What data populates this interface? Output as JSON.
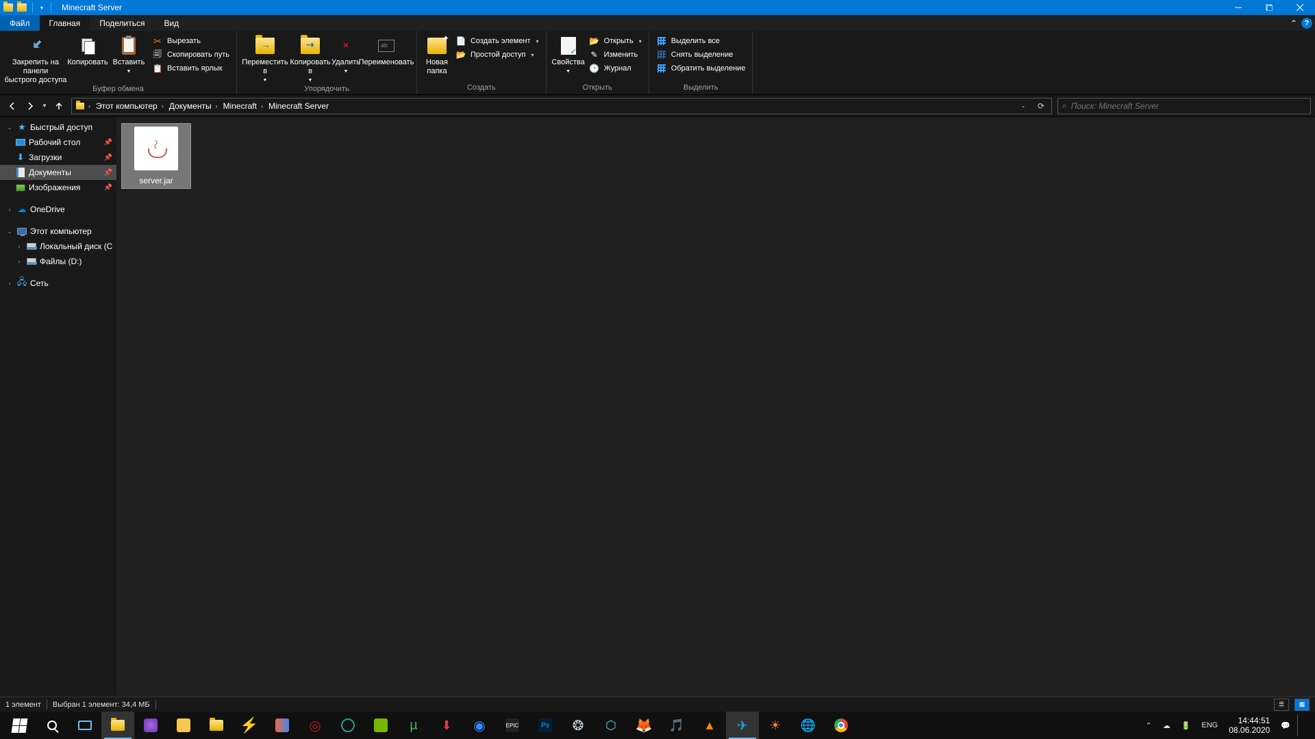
{
  "window": {
    "title": "Minecraft Server"
  },
  "tabs": {
    "file": "Файл",
    "home": "Главная",
    "share": "Поделиться",
    "view": "Вид"
  },
  "ribbon": {
    "pin": "Закрепить на панели\nбыстрого доступа",
    "copy": "Копировать",
    "paste": "Вставить",
    "cut": "Вырезать",
    "copy_path": "Скопировать путь",
    "paste_shortcut": "Вставить ярлык",
    "clipboard_group": "Буфер обмена",
    "move_to": "Переместить в",
    "copy_to": "Копировать в",
    "delete": "Удалить",
    "rename": "Переименовать",
    "organize_group": "Упорядочить",
    "new_folder": "Новая папка",
    "new_item": "Создать элемент",
    "easy_access": "Простой доступ",
    "create_group": "Создать",
    "properties": "Свойства",
    "open": "Открыть",
    "edit": "Изменить",
    "history": "Журнал",
    "open_group": "Открыть",
    "select_all": "Выделить все",
    "select_none": "Снять выделение",
    "invert_sel": "Обратить выделение",
    "select_group": "Выделить"
  },
  "breadcrumbs": [
    "Этот компьютер",
    "Документы",
    "Minecraft",
    "Minecraft Server"
  ],
  "search": {
    "placeholder": "Поиск: Minecraft Server"
  },
  "sidebar": {
    "quick_access": "Быстрый доступ",
    "desktop": "Рабочий стол",
    "downloads": "Загрузки",
    "documents": "Документы",
    "pictures": "Изображения",
    "onedrive": "OneDrive",
    "this_pc": "Этот компьютер",
    "local_disk": "Локальный диск (C",
    "files_d": "Файлы (D:)",
    "network": "Сеть"
  },
  "files": [
    {
      "name": "server.jar"
    }
  ],
  "status": {
    "count": "1 элемент",
    "selected": "Выбран 1 элемент: 34,4 МБ"
  },
  "tray": {
    "lang": "ENG",
    "time": "14:44:51",
    "date": "08.06.2020"
  }
}
